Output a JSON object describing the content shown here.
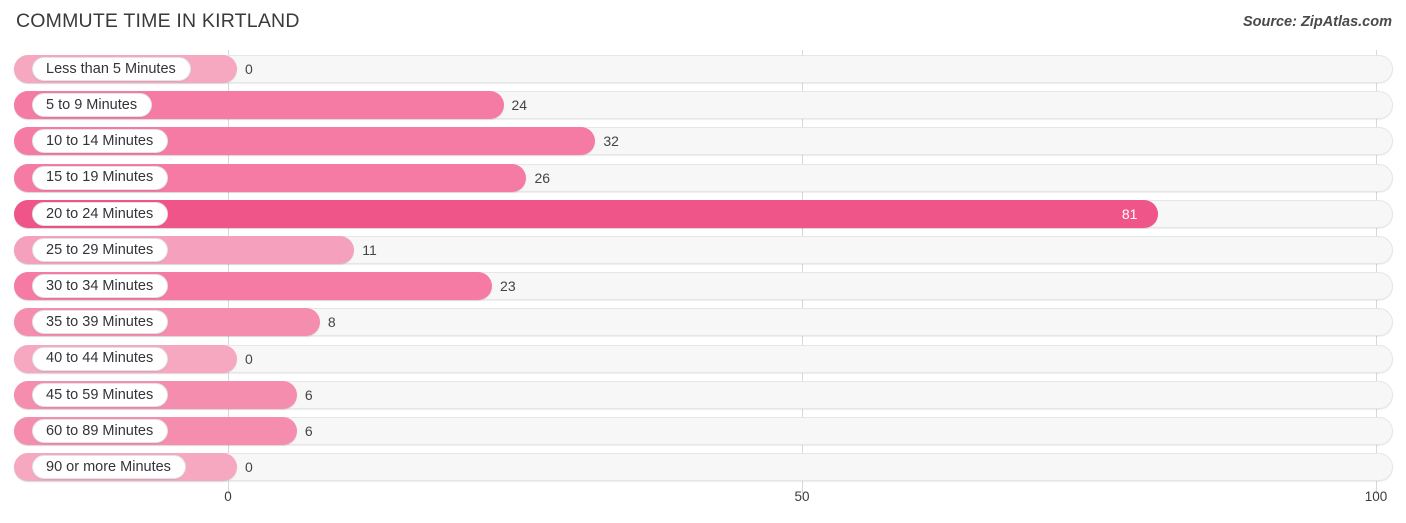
{
  "header": {
    "title": "COMMUTE TIME IN KIRTLAND",
    "source": "Source: ZipAtlas.com"
  },
  "colors": {
    "bar_default": "#F57BA4",
    "bar_light": "#F5A8C0",
    "bar_highlight": "#F0558A",
    "track": "#F7F7F7",
    "gridline": "#D8D8D8",
    "text": "#333333"
  },
  "axis": {
    "ticks": [
      {
        "label": "0",
        "value": 0
      },
      {
        "label": "50",
        "value": 50
      },
      {
        "label": "100",
        "value": 100
      }
    ],
    "min": 0,
    "max": 100
  },
  "chart_data": {
    "type": "bar",
    "orientation": "horizontal",
    "title": "COMMUTE TIME IN KIRTLAND",
    "xlabel": "",
    "ylabel": "",
    "xlim": [
      0,
      100
    ],
    "grid": true,
    "legend": false,
    "source": "Source: ZipAtlas.com",
    "categories": [
      "Less than 5 Minutes",
      "5 to 9 Minutes",
      "10 to 14 Minutes",
      "15 to 19 Minutes",
      "20 to 24 Minutes",
      "25 to 29 Minutes",
      "30 to 34 Minutes",
      "35 to 39 Minutes",
      "40 to 44 Minutes",
      "45 to 59 Minutes",
      "60 to 89 Minutes",
      "90 or more Minutes"
    ],
    "values": [
      0,
      24,
      32,
      26,
      81,
      11,
      23,
      8,
      0,
      6,
      6,
      0
    ],
    "value_labels": [
      "0",
      "24",
      "32",
      "26",
      "81",
      "11",
      "23",
      "8",
      "0",
      "6",
      "6",
      "0"
    ],
    "bars": [
      {
        "label": "Less than 5 Minutes",
        "value": 0,
        "value_label": "0",
        "color": "#F5A8C0",
        "label_inside": false
      },
      {
        "label": "5 to 9 Minutes",
        "value": 24,
        "value_label": "24",
        "color": "#F57BA4",
        "label_inside": false
      },
      {
        "label": "10 to 14 Minutes",
        "value": 32,
        "value_label": "32",
        "color": "#F57BA4",
        "label_inside": false
      },
      {
        "label": "15 to 19 Minutes",
        "value": 26,
        "value_label": "26",
        "color": "#F57BA4",
        "label_inside": false
      },
      {
        "label": "20 to 24 Minutes",
        "value": 81,
        "value_label": "81",
        "color": "#F0558A",
        "label_inside": true
      },
      {
        "label": "25 to 29 Minutes",
        "value": 11,
        "value_label": "11",
        "color": "#F5A0BD",
        "label_inside": false
      },
      {
        "label": "30 to 34 Minutes",
        "value": 23,
        "value_label": "23",
        "color": "#F57BA4",
        "label_inside": false
      },
      {
        "label": "35 to 39 Minutes",
        "value": 8,
        "value_label": "8",
        "color": "#F58DAF",
        "label_inside": false
      },
      {
        "label": "40 to 44 Minutes",
        "value": 0,
        "value_label": "0",
        "color": "#F5A8C0",
        "label_inside": false
      },
      {
        "label": "45 to 59 Minutes",
        "value": 6,
        "value_label": "6",
        "color": "#F58DAF",
        "label_inside": false
      },
      {
        "label": "60 to 89 Minutes",
        "value": 6,
        "value_label": "6",
        "color": "#F58DAF",
        "label_inside": false
      },
      {
        "label": "90 or more Minutes",
        "value": 0,
        "value_label": "0",
        "color": "#F5A8C0",
        "label_inside": false
      }
    ]
  }
}
